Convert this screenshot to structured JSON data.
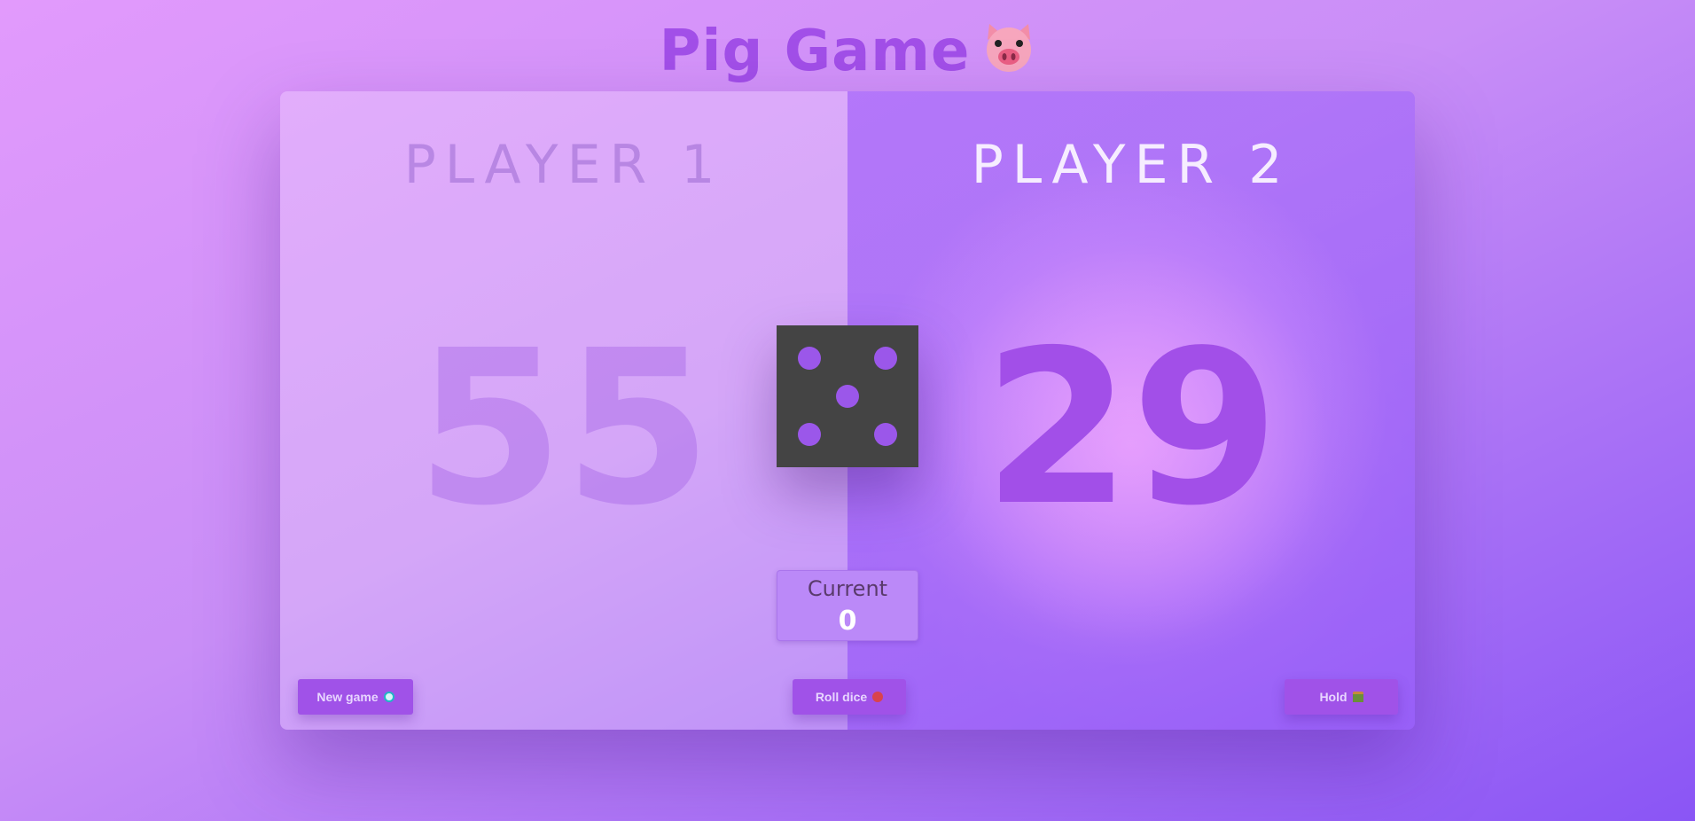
{
  "app": {
    "title": "Pig Game",
    "title_icon": "pig-face-icon"
  },
  "players": [
    {
      "name": "PLAYER 1",
      "score": "55",
      "active": false
    },
    {
      "name": "PLAYER 2",
      "score": "29",
      "active": true
    }
  ],
  "dice": {
    "value": 5,
    "icon": "dice-five-icon"
  },
  "current": {
    "label": "Current",
    "score": "0"
  },
  "buttons": {
    "new_game": "New game",
    "new_game_icon": "refresh-icon",
    "roll_dice": "Roll dice",
    "roll_dice_icon": "dice-icon",
    "hold": "Hold",
    "hold_icon": "inbox-tray-icon"
  },
  "colors": {
    "accent": "#a24fe8",
    "dice_face": "#444444",
    "pip": "#9b57ea"
  }
}
